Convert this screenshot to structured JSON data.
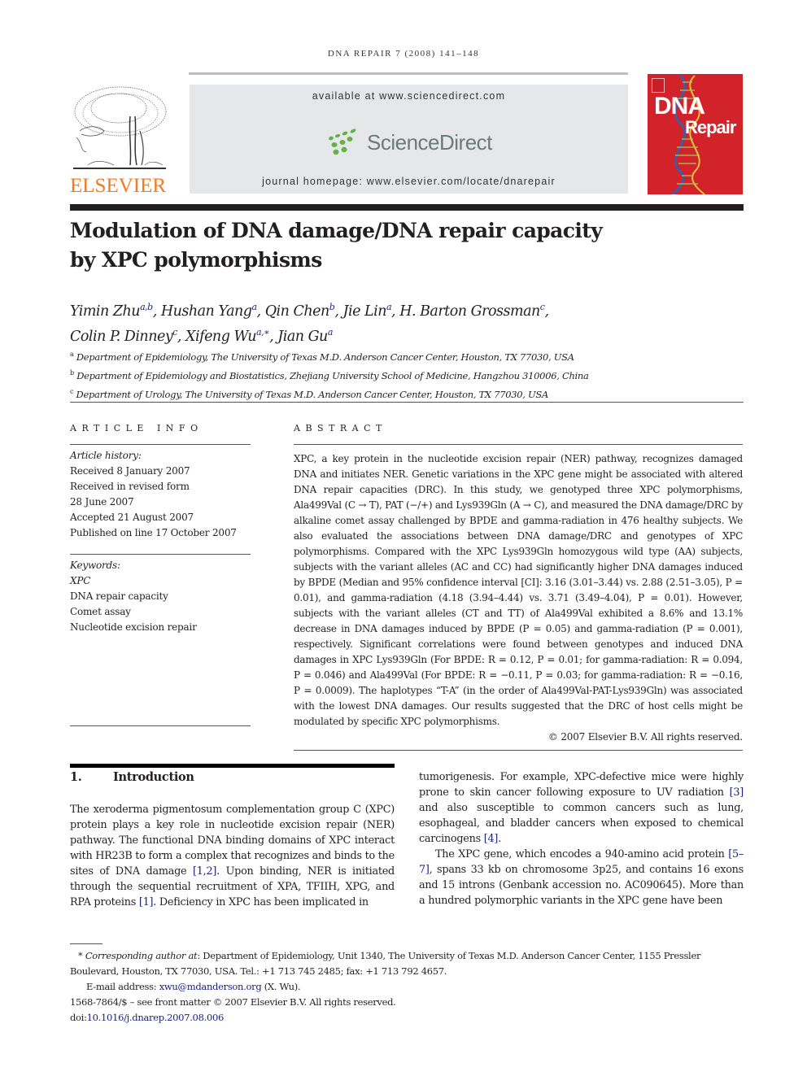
{
  "running_head": "DNA REPAIR 7 (2008) 141–148",
  "header": {
    "publisher_logo_text": "ELSEVIER",
    "available_at": "available at www.sciencedirect.com",
    "sciencedirect_logo_text": "ScienceDirect",
    "journal_homepage": "journal homepage: www.elsevier.com/locate/dnarepair",
    "cover": {
      "title_line1": "DNA",
      "title_line2": "Repair",
      "background_color": "#d2232a"
    }
  },
  "article": {
    "title_line1": "Modulation of DNA damage/DNA repair capacity",
    "title_line2": "by XPC polymorphisms",
    "authors": [
      {
        "name": "Yimin Zhu",
        "affil": "a,b"
      },
      {
        "name": "Hushan Yang",
        "affil": "a"
      },
      {
        "name": "Qin Chen",
        "affil": "b"
      },
      {
        "name": "Jie Lin",
        "affil": "a"
      },
      {
        "name": "H. Barton Grossman",
        "affil": "c"
      },
      {
        "name": "Colin P. Dinney",
        "affil": "c"
      },
      {
        "name": "Xifeng Wu",
        "affil": "a,∗"
      },
      {
        "name": "Jian Gu",
        "affil": "a"
      }
    ],
    "affiliations": [
      {
        "key": "a",
        "text": "Department of Epidemiology, The University of Texas M.D. Anderson Cancer Center, Houston, TX 77030, USA"
      },
      {
        "key": "b",
        "text": "Department of Epidemiology and Biostatistics, Zhejiang University School of Medicine, Hangzhou 310006, China"
      },
      {
        "key": "c",
        "text": "Department of Urology, The University of Texas M.D. Anderson Cancer Center, Houston, TX 77030, USA"
      }
    ]
  },
  "article_info": {
    "heading": "ARTICLE INFO",
    "history_label": "Article history:",
    "history": [
      "Received 8 January 2007",
      "Received in revised form",
      "28 June 2007",
      "Accepted 21 August 2007",
      "Published on line 17 October 2007"
    ],
    "keywords_label": "Keywords:",
    "keywords": [
      "XPC",
      "DNA repair capacity",
      "Comet assay",
      "Nucleotide excision repair"
    ]
  },
  "abstract": {
    "heading": "ABSTRACT",
    "text": "XPC, a key protein in the nucleotide excision repair (NER) pathway, recognizes damaged DNA and initiates NER. Genetic variations in the XPC gene might be associated with altered DNA repair capacities (DRC). In this study, we genotyped three XPC polymorphisms, Ala499Val (C → T), PAT (−/+) and Lys939Gln (A → C), and measured the DNA damage/DRC by alkaline comet assay challenged by BPDE and gamma-radiation in 476 healthy subjects. We also eval­uated the associations between DNA damage/DRC and genotypes of XPC polymorphisms. Compared with the XPC Lys939Gln homozygous wild type (AA) subjects, subjects with the variant alleles (AC and CC) had significantly higher DNA damages induced by BPDE (Median and 95% confidence interval [CI]: 3.16 (3.01–3.44) vs. 2.88 (2.51–3.05), P = 0.01), and gamma-radiation (4.18 (3.94–4.44) vs. 3.71 (3.49–4.04), P = 0.01). However, subjects with the variant alleles (CT and TT) of Ala499Val exhibited a 8.6% and 13.1% decrease in DNA damages induced by BPDE (P = 0.05) and gamma-radiation (P = 0.001), respectively. Significant corre­lations were found between genotypes and induced DNA damages in XPC Lys939Gln (For BPDE: R = 0.12, P = 0.01; for gamma-radiation: R = 0.094, P = 0.046) and Ala499Val (For BPDE: R = −0.11, P = 0.03; for gamma-radiation: R = −0.16, P = 0.0009). The haplotypes “T-A” (in the order of Ala499Val-PAT-Lys939Gln) was associated with the lowest DNA damages. Our results suggested that the DRC of host cells might be modulated by specific XPC polymorphisms.",
    "copyright": "© 2007 Elsevier B.V. All rights reserved."
  },
  "introduction": {
    "number": "1.",
    "heading": "Introduction",
    "p1_a": "The xeroderma pigmentosum complementation group C (XPC) protein plays a key role in nucleotide excision repair (NER) pathway. The functional DNA binding domains of XPC inter­act with HR23B to form a complex that recognizes and binds to the sites of DNA damage ",
    "p1_ref1": "[1,2]",
    "p1_b": ". Upon binding, NER is initi­ated through the sequential recruitment of XPA, TFIIH, XPG, and RPA proteins ",
    "p1_ref2": "[1]",
    "p1_c": ". Deficiency in XPC has been implicated in tumorigenesis. For example, XPC-defective mice were highly prone to skin cancer following exposure to UV radiation ",
    "p1_ref3": "[3]",
    "p1_d": " and also susceptible to common cancers such as lung, esophageal, and bladder cancers when exposed to chemical carcinogens ",
    "p1_ref4": "[4]",
    "p1_e": ".",
    "p2_a": "The XPC gene, which encodes a 940-amino acid protein ",
    "p2_ref1": "[5–7]",
    "p2_b": ", spans 33 kb on chromosome 3p25, and contains 16 exons and 15 introns (Genbank accession no. AC090645). More than a hundred polymorphic variants in the XPC gene have been"
  },
  "footnotes": {
    "corresponding_label": "Corresponding author at",
    "corresponding_text": ": Department of Epidemiology, Unit 1340, The University of Texas M.D. Anderson Cancer Center, 1155 Pressler Boulevard, Houston, TX 77030, USA. Tel.: +1 713 745 2485; fax: +1 713 792 4657.",
    "email_label": "E-mail address: ",
    "email": "xwu@mdanderson.org",
    "email_suffix": " (X. Wu).",
    "front_matter": "1568-7864/$ – see front matter © 2007 Elsevier B.V. All rights reserved.",
    "doi_label": "doi:",
    "doi": "10.1016/j.dnarep.2007.08.006"
  }
}
